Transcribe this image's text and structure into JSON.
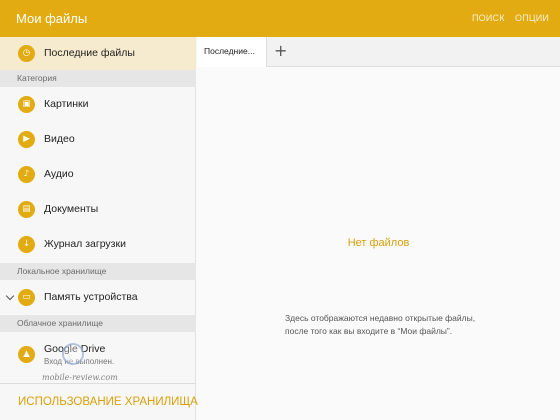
{
  "header": {
    "title": "Мои файлы",
    "search": "ПОИСК",
    "options": "ОПЦИИ"
  },
  "sidebar": {
    "recent": {
      "label": "Последние файлы",
      "icon": "clock-icon"
    },
    "section_category": "Категория",
    "items": [
      {
        "label": "Картинки",
        "icon": "image-icon"
      },
      {
        "label": "Видео",
        "icon": "video-icon"
      },
      {
        "label": "Аудио",
        "icon": "music-note-icon"
      },
      {
        "label": "Документы",
        "icon": "document-icon"
      },
      {
        "label": "Журнал загрузки",
        "icon": "download-icon"
      }
    ],
    "section_local": "Локальное хранилище",
    "device": {
      "label": "Память устройства",
      "icon": "device-icon"
    },
    "section_cloud": "Облачное хранилище",
    "drive": {
      "label": "Google Drive",
      "status": "Вход не выполнен.",
      "icon": "google-drive-icon"
    },
    "storage_usage": "ИСПОЛЬЗОВАНИЕ ХРАНИЛИЩА"
  },
  "tabs": {
    "active": "Последние...",
    "add": "+"
  },
  "main": {
    "empty_title": "Нет файлов",
    "empty_desc": "Здесь отображаются недавно открытые файлы, после того как вы входите в “Мои файлы”."
  },
  "watermark": "mobile-review.com",
  "colors": {
    "accent": "#E2AB11",
    "accent_text": "#D9A00C",
    "selected_bg": "#F6EBCF"
  }
}
